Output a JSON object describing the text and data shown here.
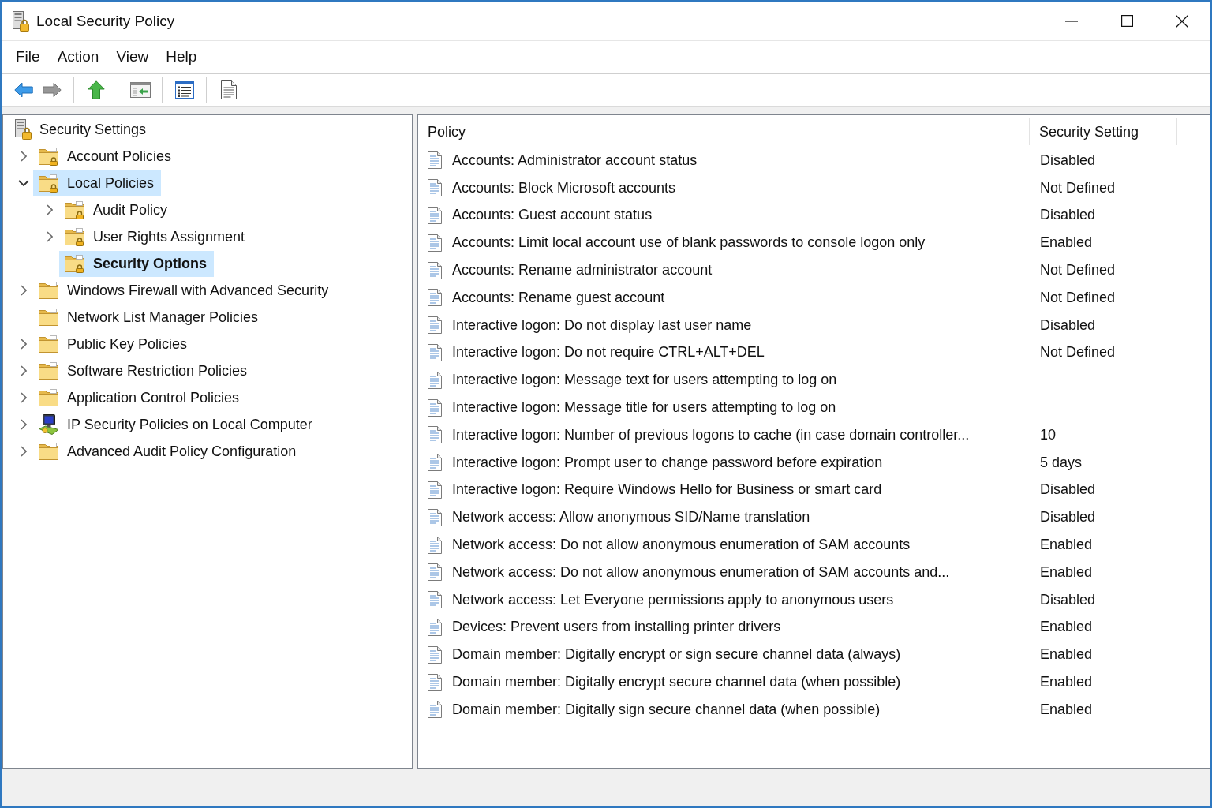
{
  "window": {
    "title": "Local Security Policy"
  },
  "menu": [
    "File",
    "Action",
    "View",
    "Help"
  ],
  "toolbar": {
    "groups": [
      {
        "buttons": [
          {
            "kind": "back",
            "disabled": false
          },
          {
            "kind": "forward",
            "disabled": true
          }
        ]
      },
      {
        "buttons": [
          {
            "kind": "up",
            "disabled": false
          }
        ]
      },
      {
        "buttons": [
          {
            "kind": "console_tree",
            "disabled": false
          }
        ]
      },
      {
        "buttons": [
          {
            "kind": "properties",
            "disabled": false
          }
        ]
      },
      {
        "buttons": [
          {
            "kind": "help",
            "disabled": false
          }
        ]
      }
    ]
  },
  "tree": [
    {
      "label": "Security Settings",
      "kind": "policy_root",
      "expandable": false,
      "selected": false,
      "highlighted": false,
      "children": [
        {
          "label": "Account Policies",
          "kind": "lock_folder",
          "expandable": true,
          "expanded": false,
          "selected": false,
          "highlighted": false
        },
        {
          "label": "Local Policies",
          "kind": "lock_folder",
          "expandable": true,
          "expanded": true,
          "selected": false,
          "highlighted": true,
          "children": [
            {
              "label": "Audit Policy",
              "kind": "lock_folder",
              "expandable": true,
              "expanded": false,
              "selected": false,
              "highlighted": false
            },
            {
              "label": "User Rights Assignment",
              "kind": "lock_folder",
              "expandable": true,
              "expanded": false,
              "selected": false,
              "highlighted": false
            },
            {
              "label": "Security Options",
              "kind": "lock_folder",
              "expandable": false,
              "selected": true,
              "highlighted": false
            }
          ]
        },
        {
          "label": "Windows Firewall with Advanced Security",
          "kind": "folder",
          "expandable": true,
          "expanded": false,
          "selected": false,
          "highlighted": false
        },
        {
          "label": "Network List Manager Policies",
          "kind": "folder",
          "expandable": false,
          "selected": false,
          "highlighted": false
        },
        {
          "label": "Public Key Policies",
          "kind": "folder",
          "expandable": true,
          "expanded": false,
          "selected": false,
          "highlighted": false
        },
        {
          "label": "Software Restriction Policies",
          "kind": "folder",
          "expandable": true,
          "expanded": false,
          "selected": false,
          "highlighted": false
        },
        {
          "label": "Application Control Policies",
          "kind": "folder",
          "expandable": true,
          "expanded": false,
          "selected": false,
          "highlighted": false
        },
        {
          "label": "IP Security Policies on Local Computer",
          "kind": "computer",
          "expandable": true,
          "expanded": false,
          "selected": false,
          "highlighted": false
        },
        {
          "label": "Advanced Audit Policy Configuration",
          "kind": "folder",
          "expandable": true,
          "expanded": false,
          "selected": false,
          "highlighted": false
        }
      ]
    }
  ],
  "policy_list": {
    "columns": [
      "Policy",
      "Security Setting"
    ],
    "rows": [
      {
        "policy": "Accounts: Administrator account status",
        "setting": "Disabled"
      },
      {
        "policy": "Accounts: Block Microsoft accounts",
        "setting": "Not Defined"
      },
      {
        "policy": "Accounts: Guest account status",
        "setting": "Disabled"
      },
      {
        "policy": "Accounts: Limit local account use of blank passwords to console logon only",
        "setting": "Enabled"
      },
      {
        "policy": "Accounts: Rename administrator account",
        "setting": "Not Defined"
      },
      {
        "policy": "Accounts: Rename guest account",
        "setting": "Not Defined"
      },
      {
        "policy": "Interactive logon: Do not display last user name",
        "setting": "Disabled"
      },
      {
        "policy": "Interactive logon: Do not require CTRL+ALT+DEL",
        "setting": "Not Defined"
      },
      {
        "policy": "Interactive logon: Message text for users attempting to log on"
      },
      {
        "policy": "Interactive logon: Message title for users attempting to log on"
      },
      {
        "policy": "Interactive logon: Number of previous logons to cache (in case domain controller...",
        "setting": "10"
      },
      {
        "policy": "Interactive logon: Prompt user to change password before expiration",
        "setting": "5 days"
      },
      {
        "policy": "Interactive logon: Require Windows Hello for Business or smart card",
        "setting": "Disabled"
      },
      {
        "policy": "Network access: Allow anonymous SID/Name translation",
        "setting": "Disabled"
      },
      {
        "policy": "Network access: Do not allow anonymous enumeration of SAM accounts",
        "setting": "Enabled"
      },
      {
        "policy": "Network access: Do not allow anonymous enumeration of SAM accounts and...",
        "setting": "Enabled"
      },
      {
        "policy": "Network access: Let Everyone permissions apply to anonymous users",
        "setting": "Disabled"
      },
      {
        "policy": "Devices: Prevent users from installing printer drivers",
        "setting": "Enabled"
      },
      {
        "policy": "Domain member: Digitally encrypt or sign secure channel data (always)",
        "setting": "Enabled"
      },
      {
        "policy": "Domain member: Digitally encrypt secure channel data (when possible)",
        "setting": "Enabled"
      },
      {
        "policy": "Domain member: Digitally sign secure channel data (when possible)",
        "setting": "Enabled"
      }
    ]
  }
}
